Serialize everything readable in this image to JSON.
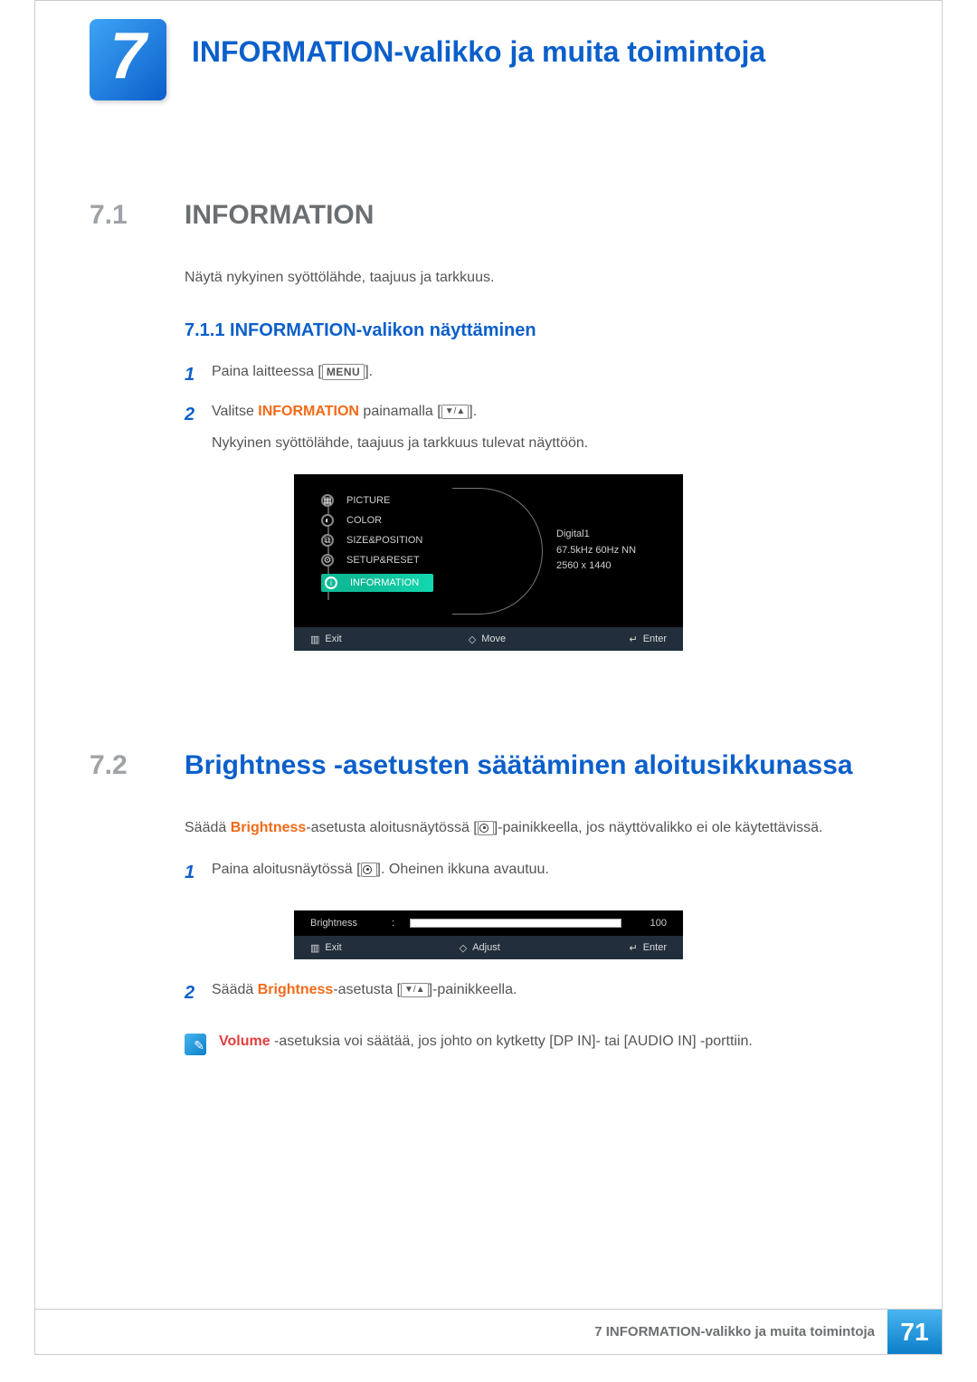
{
  "chapter": {
    "number": "7",
    "title": "INFORMATION-valikko ja muita toimintoja"
  },
  "section71": {
    "num": "7.1",
    "title": "INFORMATION",
    "intro": "Näytä nykyinen syöttölähde, taajuus ja tarkkuus.",
    "sub": {
      "num_title": "7.1.1   INFORMATION-valikon näyttäminen"
    },
    "step1_pre": "Paina laitteessa [",
    "step1_btn": "MENU",
    "step1_post": "].",
    "step2_pre": "Valitse ",
    "step2_hl": "INFORMATION",
    "step2_mid": " painamalla [",
    "step2_post": "].",
    "step2_note": "Nykyinen syöttölähde, taajuus ja tarkkuus tulevat näyttöön."
  },
  "osd1": {
    "items": [
      "PICTURE",
      "COLOR",
      "SIZE&POSITION",
      "SETUP&RESET",
      "INFORMATION"
    ],
    "info": {
      "source": "Digital1",
      "freq": "67.5kHz 60Hz NN",
      "res": "2560 x 1440"
    },
    "footer": {
      "exit": "Exit",
      "move": "Move",
      "enter": "Enter"
    }
  },
  "section72": {
    "num": "7.2",
    "title": "Brightness -asetusten säätäminen aloitusikkunassa",
    "intro_pre": "Säädä ",
    "intro_hl": "Brightness",
    "intro_post": "-asetusta aloitusnäytössä [",
    "intro_end": "]-painikkeella, jos näyttövalikko ei ole käytettävissä.",
    "step1_pre": "Paina aloitusnäytössä [",
    "step1_post": "]. Oheinen ikkuna avautuu.",
    "step2_pre": "Säädä ",
    "step2_hl": "Brightness",
    "step2_mid": "-asetusta [",
    "step2_post": "]-painikkeella.",
    "note_hl": "Volume",
    "note_rest": "  -asetuksia voi säätää, jos johto on kytketty [DP IN]- tai [AUDIO IN] -porttiin."
  },
  "osd2": {
    "label": "Brightness",
    "value": "100",
    "footer": {
      "exit": "Exit",
      "adjust": "Adjust",
      "enter": "Enter"
    }
  },
  "footer": {
    "text": "7 INFORMATION-valikko ja muita toimintoja",
    "page": "71"
  }
}
